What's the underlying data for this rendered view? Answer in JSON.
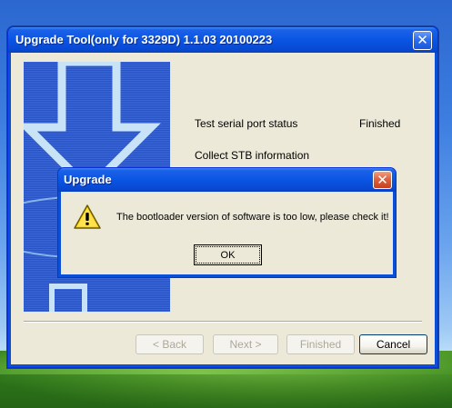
{
  "main_window": {
    "title": "Upgrade Tool(only for 3329D) 1.1.03 20100223",
    "close_glyph": "✕",
    "steps": [
      {
        "label": "Test serial port status",
        "status": "Finished"
      },
      {
        "label": "Collect STB information",
        "status": ""
      }
    ],
    "buttons": {
      "back": "< Back",
      "next": "Next >",
      "finished": "Finished",
      "cancel": "Cancel"
    },
    "wizard_image_icon": "download-arrow-icon"
  },
  "dialog": {
    "title": "Upgrade",
    "close_glyph": "✕",
    "icon": "warning-icon",
    "message": "The bootloader version of software is too low, please check it!",
    "ok_label": "OK"
  },
  "colors": {
    "titlebar_blue": "#0a55e3",
    "client_bg": "#ece9d8",
    "close_red": "#e0613d",
    "warning_yellow": "#ffd700"
  }
}
